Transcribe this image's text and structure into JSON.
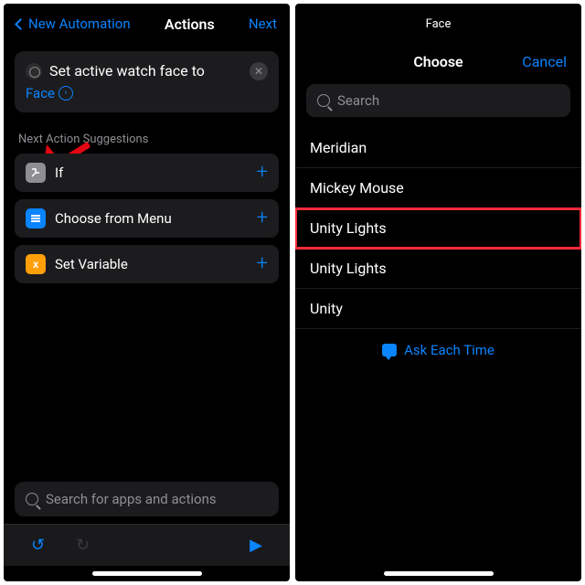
{
  "left": {
    "nav": {
      "back": "New Automation",
      "title": "Actions",
      "next": "Next"
    },
    "card": {
      "title": "Set active watch face to",
      "face": "Face"
    },
    "section": "Next Action Suggestions",
    "suggestions": [
      {
        "icon": "if",
        "label": "If"
      },
      {
        "icon": "menu",
        "label": "Choose from Menu"
      },
      {
        "icon": "var",
        "label": "Set Variable"
      }
    ],
    "search_placeholder": "Search for apps and actions"
  },
  "right": {
    "subtitle": "Face",
    "choose": "Choose",
    "cancel": "Cancel",
    "search_placeholder": "Search",
    "items": [
      "Meridian",
      "Mickey Mouse",
      "Unity Lights",
      "Unity Lights",
      "Unity"
    ],
    "highlight_index": 2,
    "ask": "Ask Each Time"
  }
}
